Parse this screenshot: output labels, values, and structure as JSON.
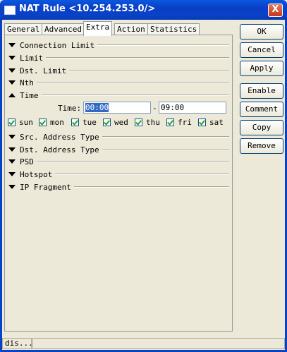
{
  "window": {
    "title": "NAT Rule <10.254.253.0/>",
    "close_label": "X"
  },
  "tabs": [
    {
      "label": "General",
      "active": false
    },
    {
      "label": "Advanced",
      "active": false
    },
    {
      "label": "Extra",
      "active": true
    },
    {
      "label": "Action",
      "active": false
    },
    {
      "label": "Statistics",
      "active": false
    }
  ],
  "sections": [
    {
      "label": "Connection Limit",
      "expanded": false
    },
    {
      "label": "Limit",
      "expanded": false
    },
    {
      "label": "Dst. Limit",
      "expanded": false
    },
    {
      "label": "Nth",
      "expanded": false
    },
    {
      "label": "Time",
      "expanded": true
    },
    {
      "label": "Src. Address Type",
      "expanded": false
    },
    {
      "label": "Dst. Address Type",
      "expanded": false
    },
    {
      "label": "PSD",
      "expanded": false
    },
    {
      "label": "Hotspot",
      "expanded": false
    },
    {
      "label": "IP Fragment",
      "expanded": false
    }
  ],
  "time": {
    "label": "Time:",
    "start": "00:00",
    "separator": "-",
    "end": "09:00"
  },
  "days": [
    {
      "label": "sun",
      "checked": true
    },
    {
      "label": "mon",
      "checked": true
    },
    {
      "label": "tue",
      "checked": true
    },
    {
      "label": "wed",
      "checked": true
    },
    {
      "label": "thu",
      "checked": true
    },
    {
      "label": "fri",
      "checked": true
    },
    {
      "label": "sat",
      "checked": true
    }
  ],
  "buttons": {
    "ok": "OK",
    "cancel": "Cancel",
    "apply": "Apply",
    "enable": "Enable",
    "comment": "Comment",
    "copy": "Copy",
    "remove": "Remove"
  },
  "status": {
    "text": "dis...",
    "secondary": ""
  },
  "icons": {
    "window": "window-icon",
    "collapsed": "triangle-down-icon",
    "expanded": "triangle-up-icon",
    "checkbox": "checkmark-icon"
  }
}
